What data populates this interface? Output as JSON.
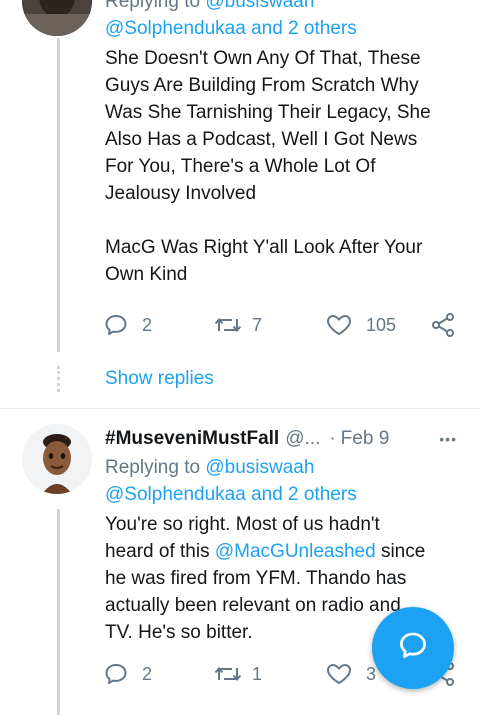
{
  "tweet1": {
    "replying_prefix": "Replying to",
    "replying_handle": "@busiswaah",
    "replying_line2": "@Solphendukaa and 2 others",
    "body_lines": [
      "She Doesn't Own Any Of That, These",
      "Guys Are Building From Scratch Why",
      "Was She Tarnishing Their Legacy, She",
      "Also Has a Podcast, Well I Got News",
      "For You, There's a Whole Lot Of",
      "Jealousy Involved",
      "",
      "MacG Was Right Y'all Look After Your",
      "Own Kind"
    ],
    "reply_count": "2",
    "retweet_count": "7",
    "like_count": "105"
  },
  "show_replies": "Show replies",
  "tweet2": {
    "display_name": "#MuseveniMustFall",
    "handle": "@...",
    "dot": "·",
    "date": "Feb 9",
    "more": "•••",
    "replying_prefix": "Replying to",
    "replying_handle": "@busiswaah",
    "replying_line2": "@Solphendukaa and 2 others",
    "body_line1": "You're so right. Most of us hadn't",
    "body_line2_prefix": "heard of this",
    "body_line2_mention": "@MacGUnleashed",
    "body_line2_suffix": "since",
    "body_line3": "he was fired from YFM. Thando has",
    "body_line4": "actually been relevant on radio and",
    "body_line5": "TV. He's so bitter.",
    "reply_count": "2",
    "retweet_count": "1",
    "like_count": "3"
  },
  "icons": {
    "reply": "speech-bubble-icon",
    "retweet": "retweet-icon",
    "like": "heart-icon",
    "share": "share-icon",
    "compose": "compose-reply-icon"
  },
  "colors": {
    "accent": "#1da1f2",
    "muted": "#657786",
    "text": "#14171a",
    "divider": "#e6ecf0",
    "thread_line": "#ccd6dd"
  }
}
